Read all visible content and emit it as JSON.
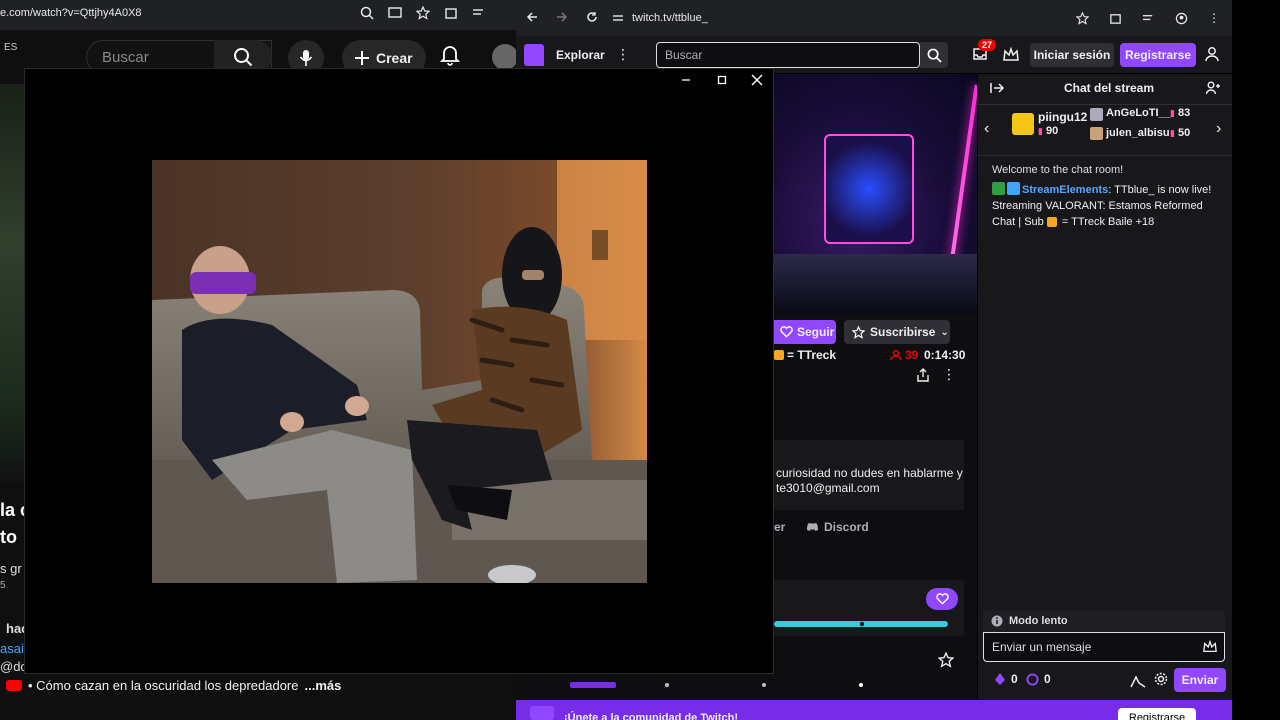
{
  "youtube": {
    "url": "e.com/watch?v=Qttjhy4A0X8",
    "lang": "ES",
    "search_placeholder": "Buscar",
    "create_label": "Crear",
    "frag_title_1": "la c",
    "frag_title_2": "to",
    "frag_sub": "s gr",
    "frag_small": "5",
    "frag_d": "d",
    "frag_hac": "hac",
    "frag_asai": "asai",
    "frag_do": "@do",
    "bottom_text": "• Cómo cazan en la oscuridad los depredadore",
    "bottom_more": "...más"
  },
  "twitch": {
    "url": "twitch.tv/ttblue_",
    "explore": "Explorar",
    "search_placeholder": "Buscar",
    "inbox_count": "27",
    "login": "Iniciar sesión",
    "signup": "Registrarse",
    "follow": "Seguir",
    "subscribe": "Suscribirse",
    "ttreck": "= TTreck",
    "viewers": "39",
    "uptime": "0:14:30",
    "about_line1": "curiosidad no dudes en hablarme y",
    "about_line2": "te3010@gmail.com",
    "link_er": "er",
    "discord": "Discord",
    "banner_text": "¡Únete a la comunidad de Twitch!",
    "banner_btn": "Registrarse"
  },
  "chat": {
    "title": "Chat del stream",
    "leaders": [
      {
        "name": "piingu12",
        "points": "90"
      },
      {
        "name": "AnGeLoTI__",
        "points": "83"
      },
      {
        "name": "julen_albisu",
        "points": "50"
      }
    ],
    "welcome": "Welcome to the chat room!",
    "message_author": "StreamElements",
    "message_text_1": ": TTblue_ is now live! Streaming VALORANT: Estamos Reformed Chat | Sub ",
    "message_text_2": " = TTreck Baile +18",
    "slow_mode": "Modo lento",
    "input_placeholder": "Enviar un mensaje",
    "bits": "0",
    "points": "0",
    "send": "Enviar"
  },
  "colors": {
    "twitch_purple": "#9147ff",
    "live_red": "#eb0400",
    "chat_author": "#58a6ff"
  }
}
